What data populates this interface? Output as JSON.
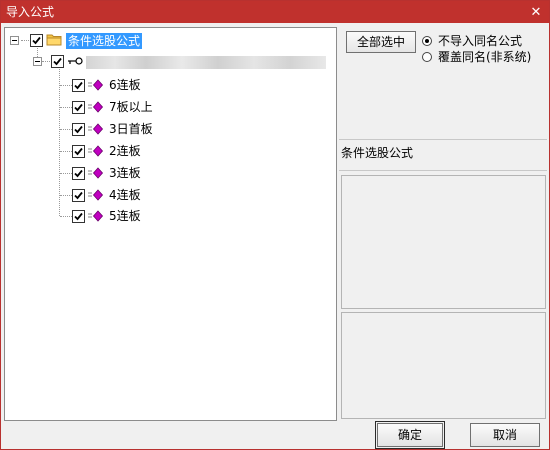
{
  "window": {
    "title": "导入公式",
    "close_glyph": "✕"
  },
  "tree": {
    "root": {
      "label": "条件选股公式",
      "checked": true,
      "icon": "folder-icon"
    },
    "group": {
      "label": "",
      "checked": true,
      "icon": "key-icon"
    },
    "items": [
      {
        "label": "6连板",
        "checked": true,
        "icon": "diamond-formula-icon"
      },
      {
        "label": "7板以上",
        "checked": true,
        "icon": "diamond-formula-icon"
      },
      {
        "label": "3日首板",
        "checked": true,
        "icon": "diamond-formula-icon"
      },
      {
        "label": "2连板",
        "checked": true,
        "icon": "diamond-formula-icon"
      },
      {
        "label": "3连板",
        "checked": true,
        "icon": "diamond-formula-icon"
      },
      {
        "label": "4连板",
        "checked": true,
        "icon": "diamond-formula-icon"
      },
      {
        "label": "5连板",
        "checked": true,
        "icon": "diamond-formula-icon"
      }
    ]
  },
  "options": {
    "select_all_label": "全部选中",
    "radio_no_import": "不导入同名公式",
    "radio_overwrite": "覆盖同名(非系统)",
    "selected": "no_import"
  },
  "info": {
    "category_text": "条件选股公式"
  },
  "footer": {
    "ok_label": "确定",
    "cancel_label": "取消"
  },
  "colors": {
    "titlebar": "#c0312d",
    "selection": "#3399ff",
    "gem": "#c000c0",
    "folder": "#f5c542"
  }
}
